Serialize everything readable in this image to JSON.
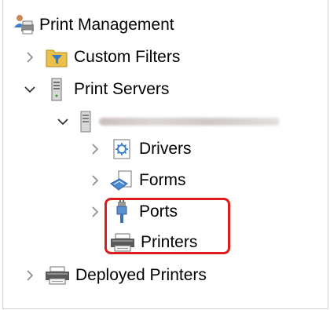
{
  "tree": {
    "root_label": "Print Management",
    "custom_filters_label": "Custom Filters",
    "print_servers_label": "Print Servers",
    "drivers_label": "Drivers",
    "forms_label": "Forms",
    "ports_label": "Ports",
    "printers_label": "Printers",
    "deployed_printers_label": "Deployed Printers"
  },
  "colors": {
    "highlight": "#e01b1b"
  }
}
